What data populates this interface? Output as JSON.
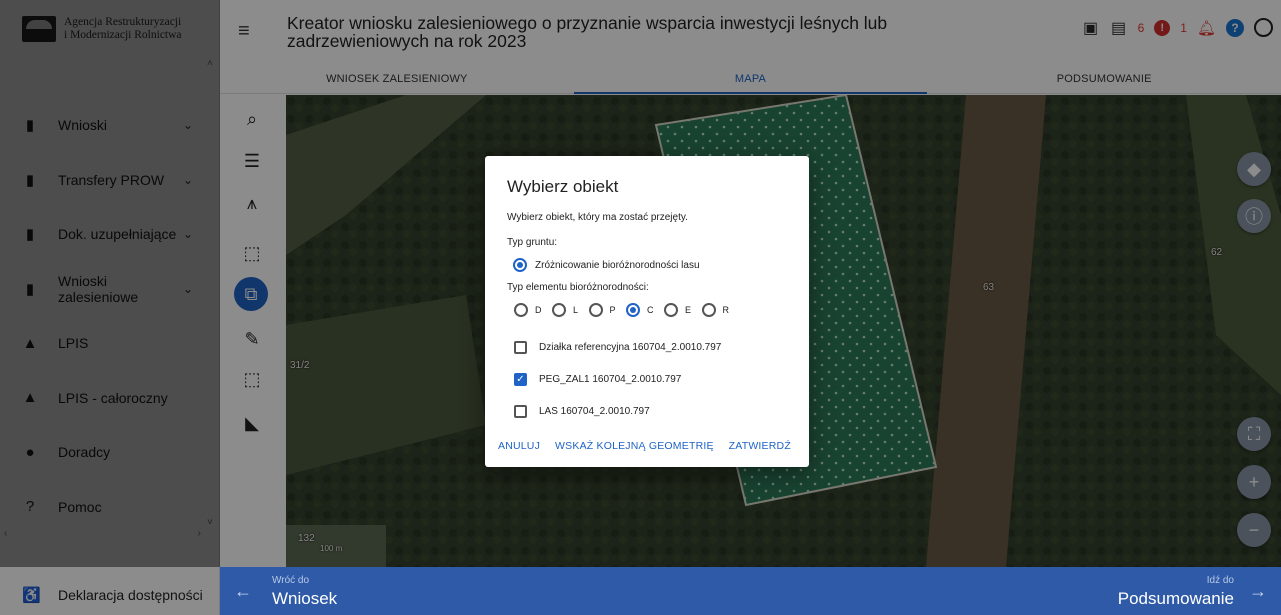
{
  "app": {
    "org_name_line1": "Agencja Restrukturyzacji",
    "org_name_line2": "i Modernizacji Rolnictwa"
  },
  "sidebar": {
    "items": [
      {
        "label": "Wnioski",
        "icon": "clipboard-icon",
        "chevron": "⌄"
      },
      {
        "label": "Transfery PROW",
        "icon": "clipboard-icon",
        "chevron": "⌄"
      },
      {
        "label": "Dok. uzupełniające",
        "icon": "clipboard-icon",
        "chevron": "⌄"
      },
      {
        "label": "Wnioski zalesieniowe",
        "icon": "clipboard-icon",
        "chevron": "⌄"
      },
      {
        "label": "LPIS",
        "icon": "terrain-icon",
        "chevron": ""
      },
      {
        "label": "LPIS - całoroczny",
        "icon": "terrain-icon",
        "chevron": ""
      },
      {
        "label": "Doradcy",
        "icon": "person-icon",
        "chevron": ""
      },
      {
        "label": "Pomoc",
        "icon": "help-icon",
        "chevron": ""
      }
    ],
    "accessibility": "Deklaracja dostępności"
  },
  "header": {
    "title": "Kreator wniosku zalesieniowego o przyznanie wsparcia inwestycji leśnych lub zadrzewieniowych na rok 2023",
    "warning_count": "6",
    "error_count": "1"
  },
  "tabs": [
    {
      "label": "WNIOSEK ZALESIENIOWY",
      "active": false
    },
    {
      "label": "MAPA",
      "active": true
    },
    {
      "label": "PODSUMOWANIE",
      "active": false
    }
  ],
  "map": {
    "labels": [
      "63",
      "62",
      "31/2",
      "132",
      "100 m"
    ]
  },
  "dialog": {
    "title": "Wybierz obiekt",
    "description": "Wybierz obiekt, który ma zostać przejęty.",
    "ground_type_label": "Typ gruntu:",
    "ground_type_option": "Zróżnicowanie bioróżnorodności lasu",
    "element_type_label": "Typ elementu bioróżnorodności:",
    "element_options": [
      "D",
      "L",
      "P",
      "C",
      "E",
      "R"
    ],
    "selected_element": "C",
    "checkboxes": [
      {
        "label": "Działka referencyjna 160704_2.0010.797",
        "checked": false
      },
      {
        "label": "PEG_ZAL1 160704_2.0010.797",
        "checked": true
      },
      {
        "label": "LAS 160704_2.0010.797",
        "checked": false
      }
    ],
    "actions": {
      "cancel": "ANULUJ",
      "next_geometry": "WSKAŻ KOLEJNĄ GEOMETRIĘ",
      "confirm": "ZATWIERDŹ"
    }
  },
  "footer": {
    "back_small": "Wróć do",
    "back_big": "Wniosek",
    "next_small": "Idź do",
    "next_big": "Podsumowanie"
  },
  "colors": {
    "accent": "#1e63c5",
    "footer": "#2f5aa8",
    "alert": "#e53935"
  }
}
